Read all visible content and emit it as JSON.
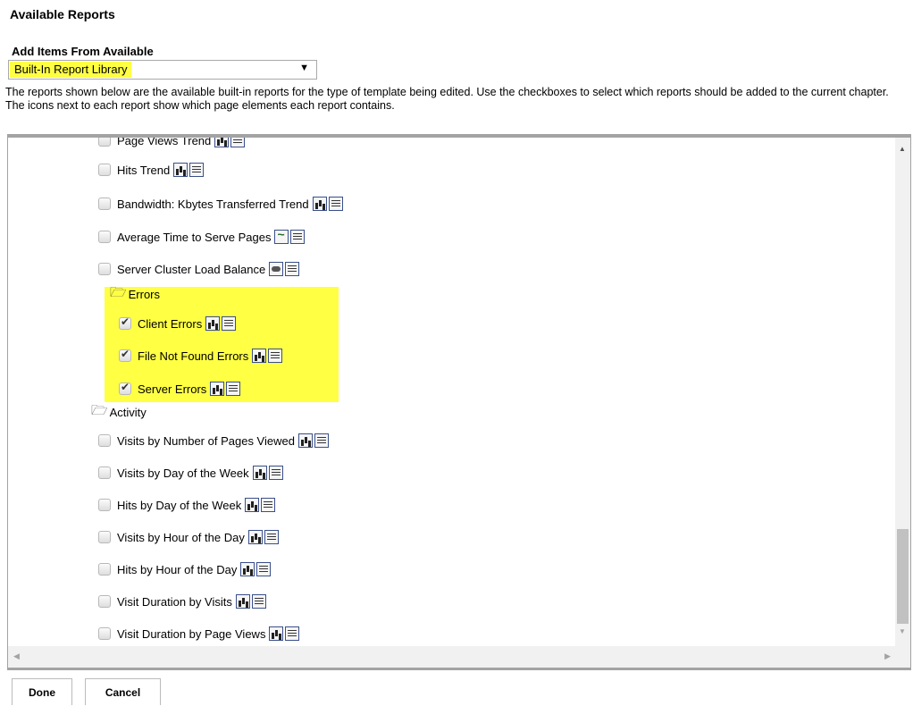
{
  "header": {
    "title": "Available Reports",
    "add_items_label": "Add Items From Available"
  },
  "source_select": {
    "value": "Built-In Report Library",
    "arrow": "▼"
  },
  "description": "The reports shown below are the available built-in reports for the type of template being edited. Use the checkboxes to select which reports should be added to the current chapter. The icons next to each report show which page elements each report contains.",
  "tree": [
    {
      "type": "report",
      "label": "Page Views Trend",
      "checked": false,
      "icons": [
        "b",
        "t"
      ]
    },
    {
      "type": "report",
      "label": "Hits Trend",
      "checked": false,
      "icons": [
        "b",
        "t"
      ]
    },
    {
      "type": "report",
      "label": "Bandwidth: Kbytes Transferred Trend",
      "checked": false,
      "icons": [
        "b",
        "t"
      ]
    },
    {
      "type": "report",
      "label": "Average Time to Serve Pages",
      "checked": false,
      "icons": [
        "w",
        "t"
      ]
    },
    {
      "type": "report",
      "label": "Server Cluster Load Balance",
      "checked": false,
      "icons": [
        "c",
        "t"
      ]
    },
    {
      "type": "folder",
      "label": "Errors"
    },
    {
      "type": "report",
      "label": "Client Errors",
      "checked": true,
      "icons": [
        "b",
        "t"
      ]
    },
    {
      "type": "report",
      "label": "File Not Found Errors",
      "checked": true,
      "icons": [
        "b",
        "t"
      ]
    },
    {
      "type": "report",
      "label": "Server Errors",
      "checked": true,
      "icons": [
        "b",
        "t"
      ]
    },
    {
      "type": "folder",
      "label": "Activity"
    },
    {
      "type": "report",
      "label": "Visits by Number of Pages Viewed",
      "checked": false,
      "icons": [
        "b",
        "t"
      ]
    },
    {
      "type": "report",
      "label": "Visits by Day of the Week",
      "checked": false,
      "icons": [
        "b",
        "t"
      ]
    },
    {
      "type": "report",
      "label": "Hits by Day of the Week",
      "checked": false,
      "icons": [
        "b",
        "t"
      ]
    },
    {
      "type": "report",
      "label": "Visits by Hour of the Day",
      "checked": false,
      "icons": [
        "b",
        "t"
      ]
    },
    {
      "type": "report",
      "label": "Hits by Hour of the Day",
      "checked": false,
      "icons": [
        "b",
        "t"
      ]
    },
    {
      "type": "report",
      "label": "Visit Duration by Visits",
      "checked": false,
      "icons": [
        "b",
        "t"
      ]
    },
    {
      "type": "report",
      "label": "Visit Duration by Page Views",
      "checked": false,
      "icons": [
        "b",
        "t"
      ]
    }
  ],
  "scroll": {
    "up": "▲",
    "down": "▼",
    "left": "◀",
    "right": "▶"
  },
  "buttons": {
    "done": "Done",
    "cancel": "Cancel"
  },
  "colors": {
    "highlight": "#ffff44",
    "border": "#a3a3a3"
  }
}
